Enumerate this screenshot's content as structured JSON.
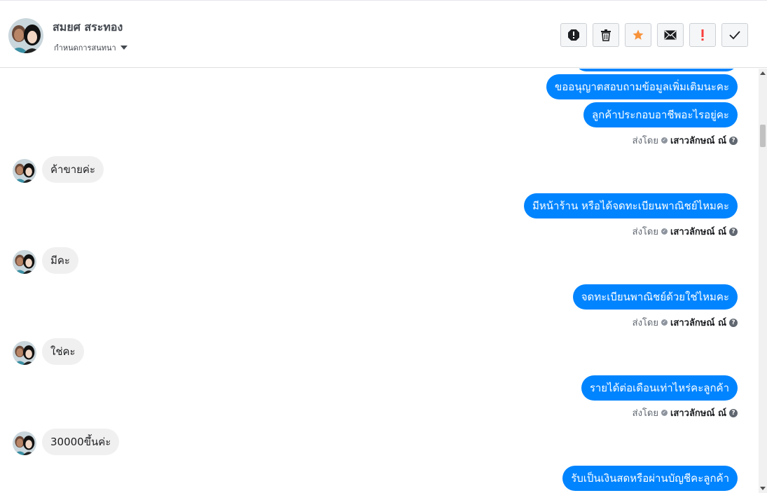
{
  "header": {
    "contact_name": "สมยศ สระทอง",
    "convo_menu_label": "กำหนดการสนทนา",
    "actions": [
      {
        "icon": "report-icon"
      },
      {
        "icon": "trash-icon"
      },
      {
        "icon": "star-icon"
      },
      {
        "icon": "mail-icon"
      },
      {
        "icon": "important-icon"
      },
      {
        "icon": "check-icon"
      }
    ]
  },
  "messages": [
    {
      "type": "out",
      "text": "ขออนุญาตสอบถามข้อมูลเพิ่มเติมนะคะ"
    },
    {
      "type": "out",
      "text": "ลูกค้าประกอบอาชีพอะไรอยู่คะ"
    },
    {
      "type": "sent_by",
      "prefix": "ส่งโดย",
      "name": "เสาวลักษณ์ ณ์"
    },
    {
      "type": "in",
      "text": "ค้าขายค่ะ"
    },
    {
      "type": "out",
      "text": "มีหน้าร้าน หรือได้จดทะเบียนพาณิชย์ไหมคะ"
    },
    {
      "type": "sent_by",
      "prefix": "ส่งโดย",
      "name": "เสาวลักษณ์ ณ์"
    },
    {
      "type": "in",
      "text": "มีคะ"
    },
    {
      "type": "out",
      "text": "จดทะเบียนพาณิชย์ด้วยใช่ไหมคะ"
    },
    {
      "type": "sent_by",
      "prefix": "ส่งโดย",
      "name": "เสาวลักษณ์ ณ์"
    },
    {
      "type": "in",
      "text": "ใช่คะ"
    },
    {
      "type": "out",
      "text": "รายได้ต่อเดือนเท่าไหร่คะลูกค้า"
    },
    {
      "type": "sent_by",
      "prefix": "ส่งโดย",
      "name": "เสาวลักษณ์ ณ์"
    },
    {
      "type": "in",
      "text": "30000ขึ้นค่ะ"
    },
    {
      "type": "out",
      "text": "รับเป็นเงินสดหรือผ่านบัญชีคะลูกค้า"
    }
  ],
  "colors": {
    "outgoing_bubble": "#0084ff",
    "incoming_bubble": "#f1f0f0",
    "star": "#f7923a",
    "important": "#fa3e3e"
  }
}
